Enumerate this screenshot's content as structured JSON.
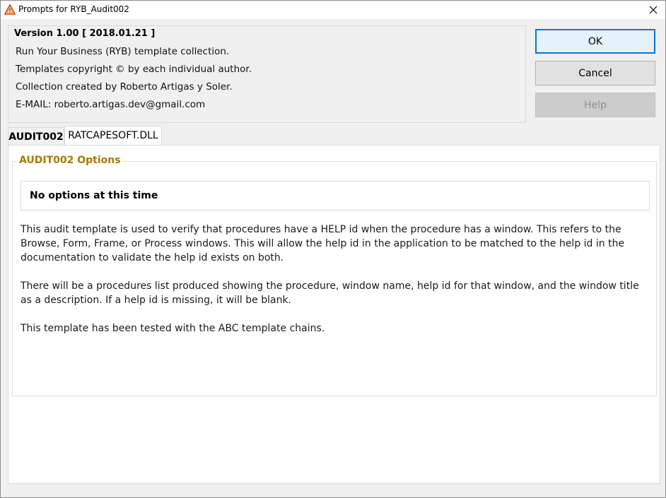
{
  "window": {
    "title": "Prompts for RYB_Audit002"
  },
  "version": {
    "title": "Version 1.00 [ 2018.01.21 ]",
    "lines": [
      "Run Your Business (RYB) template collection.",
      "Templates copyright © by each individual author.",
      "Collection created by Roberto Artigas y Soler.",
      "E-MAIL: roberto.artigas.dev@gmail.com"
    ]
  },
  "buttons": {
    "ok": "OK",
    "cancel": "Cancel",
    "help": "Help"
  },
  "tabs": [
    {
      "label": "AUDIT002",
      "active": true
    },
    {
      "label": "RATCAPESOFT.DLL",
      "active": false
    }
  ],
  "options": {
    "group_title": "AUDIT002 Options",
    "notice": "No options at this time",
    "paragraphs": [
      "This audit template is used to verify that procedures have a HELP id when the procedure has a window. This refers to the Browse, Form, Frame, or Process windows. This will allow the help id in the application to be matched to the help id in the documentation to validate the help id exists on both.",
      "There will be a procedures list produced showing the procedure, window name, help id for that window, and the window title as a description. If a help id is missing, it will be blank.",
      "This template has been tested with the ABC template chains."
    ]
  },
  "icons": {
    "app": "triangle-app-icon",
    "close": "close-icon"
  },
  "colors": {
    "group_title": "#a67a00",
    "ok_border": "#0078d7"
  }
}
